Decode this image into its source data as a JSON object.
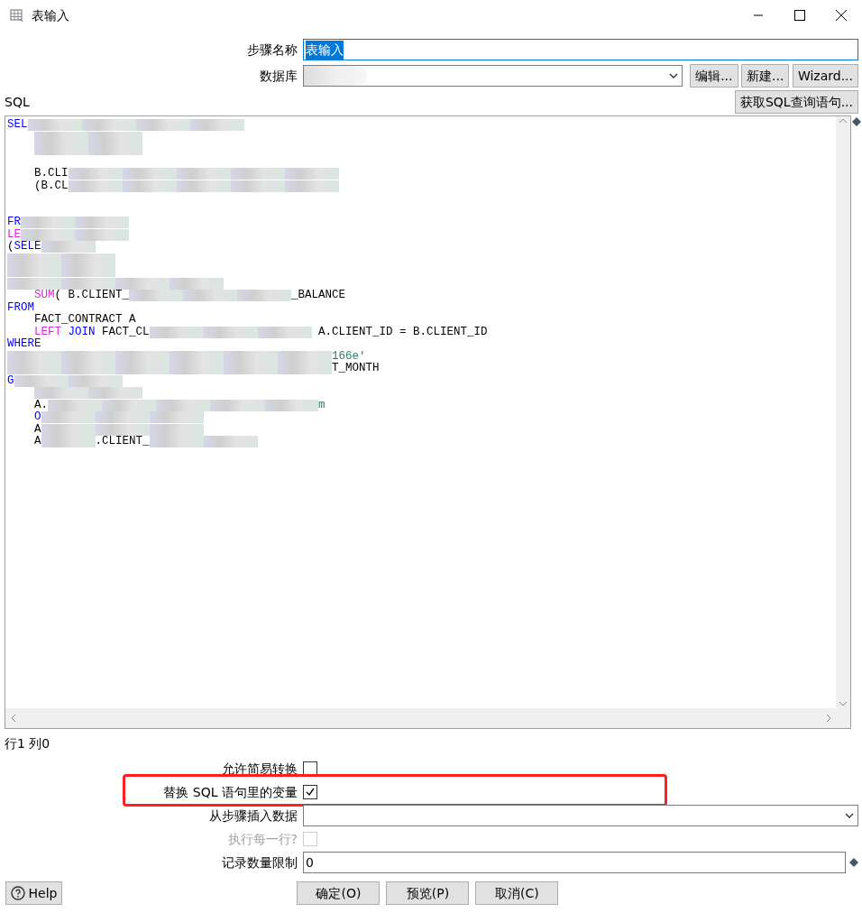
{
  "window": {
    "title": "表输入"
  },
  "step_name": {
    "label": "步骤名称",
    "value": "表输入"
  },
  "database": {
    "label": "数据库",
    "redacted": true,
    "buttons": [
      "编辑...",
      "新建...",
      "Wizard..."
    ]
  },
  "sql": {
    "label": "SQL",
    "fetch_button": "获取SQL查询语句...",
    "lines": [
      {
        "kind": "flush",
        "tokens": [
          {
            "kind": "keyword",
            "text": "SEL"
          },
          {
            "kind": "redacted"
          },
          {
            "kind": "redacted"
          },
          {
            "kind": "redacted"
          },
          {
            "kind": "redacted"
          }
        ]
      },
      {
        "kind": "indented",
        "tokens": [
          {
            "kind": "redacted"
          },
          {
            "kind": "redacted"
          }
        ]
      },
      {
        "kind": "indented",
        "tokens": [
          {
            "kind": "redacted"
          },
          {
            "kind": "redacted"
          }
        ]
      },
      {
        "kind": "blank"
      },
      {
        "kind": "indented",
        "tokens": [
          {
            "kind": "plain",
            "text": "B.CLI"
          },
          {
            "kind": "redacted"
          },
          {
            "kind": "redacted"
          },
          {
            "kind": "redacted"
          },
          {
            "kind": "redacted"
          },
          {
            "kind": "redacted"
          }
        ]
      },
      {
        "kind": "indented",
        "tokens": [
          {
            "kind": "plain",
            "text": "(B.CL"
          },
          {
            "kind": "redacted"
          },
          {
            "kind": "redacted"
          },
          {
            "kind": "redacted"
          },
          {
            "kind": "redacted"
          },
          {
            "kind": "redacted"
          }
        ]
      },
      {
        "kind": "blank"
      },
      {
        "kind": "blank"
      },
      {
        "kind": "flush",
        "tokens": [
          {
            "kind": "keyword",
            "text": "FR"
          },
          {
            "kind": "redacted"
          },
          {
            "kind": "redacted"
          }
        ]
      },
      {
        "kind": "flush",
        "tokens": [
          {
            "kind": "function",
            "text": "LE"
          },
          {
            "kind": "redacted"
          },
          {
            "kind": "redacted"
          }
        ]
      },
      {
        "kind": "flush",
        "tokens": [
          {
            "kind": "plain",
            "text": "("
          },
          {
            "kind": "keyword",
            "text": "SELE"
          },
          {
            "kind": "redacted"
          }
        ]
      },
      {
        "kind": "flush",
        "tokens": [
          {
            "kind": "redacted"
          },
          {
            "kind": "redacted"
          }
        ]
      },
      {
        "kind": "flush",
        "tokens": [
          {
            "kind": "redacted"
          },
          {
            "kind": "redacted"
          }
        ]
      },
      {
        "kind": "flush",
        "tokens": [
          {
            "kind": "redacted"
          },
          {
            "kind": "redacted"
          },
          {
            "kind": "redacted"
          },
          {
            "kind": "redacted"
          }
        ]
      },
      {
        "kind": "indented",
        "tokens": [
          {
            "kind": "function",
            "text": "SUM"
          },
          {
            "kind": "plain",
            "text": "( B.CLIENT_"
          },
          {
            "kind": "redacted"
          },
          {
            "kind": "redacted"
          },
          {
            "kind": "redacted"
          },
          {
            "kind": "plain",
            "text": "_BALANCE"
          }
        ]
      },
      {
        "kind": "flush",
        "tokens": [
          {
            "kind": "keyword",
            "text": "FROM"
          }
        ]
      },
      {
        "kind": "indented",
        "tokens": [
          {
            "kind": "plain",
            "text": "FACT_CONTRACT A"
          }
        ]
      },
      {
        "kind": "indented",
        "tokens": [
          {
            "kind": "function",
            "text": "LEFT"
          },
          {
            "kind": "keyword",
            "text": " JOIN"
          },
          {
            "kind": "plain",
            "text": " FACT_CL"
          },
          {
            "kind": "redacted"
          },
          {
            "kind": "redacted"
          },
          {
            "kind": "redacted"
          },
          {
            "kind": "plain",
            "text": " A.CLIENT_ID = B.CLIENT_ID"
          }
        ]
      },
      {
        "kind": "flush",
        "tokens": [
          {
            "kind": "keyword",
            "text": "WHERE"
          }
        ]
      },
      {
        "kind": "flush",
        "tokens": [
          {
            "kind": "redacted"
          },
          {
            "kind": "redacted"
          },
          {
            "kind": "redacted"
          },
          {
            "kind": "redacted"
          },
          {
            "kind": "redacted"
          },
          {
            "kind": "redacted"
          },
          {
            "kind": "string",
            "text": "166e'"
          }
        ]
      },
      {
        "kind": "flush",
        "tokens": [
          {
            "kind": "redacted"
          },
          {
            "kind": "redacted"
          },
          {
            "kind": "redacted"
          },
          {
            "kind": "redacted"
          },
          {
            "kind": "redacted"
          },
          {
            "kind": "redacted"
          },
          {
            "kind": "plain",
            "text": "T_MONTH"
          }
        ]
      },
      {
        "kind": "flush",
        "tokens": [
          {
            "kind": "keyword",
            "text": "G"
          },
          {
            "kind": "redacted"
          },
          {
            "kind": "redacted"
          }
        ]
      },
      {
        "kind": "indented",
        "tokens": [
          {
            "kind": "redacted"
          },
          {
            "kind": "redacted"
          }
        ]
      },
      {
        "kind": "indented",
        "tokens": [
          {
            "kind": "plain",
            "text": "A."
          },
          {
            "kind": "redacted"
          },
          {
            "kind": "redacted"
          },
          {
            "kind": "redacted"
          },
          {
            "kind": "redacted"
          },
          {
            "kind": "redacted"
          },
          {
            "kind": "string",
            "text": "m"
          }
        ]
      },
      {
        "kind": "indented",
        "tokens": [
          {
            "kind": "keyword",
            "text": "O"
          },
          {
            "kind": "redacted"
          },
          {
            "kind": "redacted"
          },
          {
            "kind": "redacted"
          }
        ]
      },
      {
        "kind": "indented",
        "tokens": [
          {
            "kind": "plain",
            "text": "A"
          },
          {
            "kind": "redacted"
          },
          {
            "kind": "redacted"
          },
          {
            "kind": "redacted"
          }
        ]
      },
      {
        "kind": "indented",
        "tokens": [
          {
            "kind": "plain",
            "text": "A"
          },
          {
            "kind": "redacted"
          },
          {
            "kind": "plain",
            "text": ".CLIENT_"
          },
          {
            "kind": "redacted"
          },
          {
            "kind": "redacted"
          }
        ]
      }
    ]
  },
  "cursor_position": "行1 列0",
  "options": [
    {
      "kind": "checkbox",
      "label": "允许简易转换",
      "checked": false,
      "disabled": false,
      "highlighted": false
    },
    {
      "kind": "checkbox",
      "label": "替换 SQL 语句里的变量",
      "checked": true,
      "disabled": false,
      "highlighted": true
    },
    {
      "kind": "dropdown",
      "label": "从步骤插入数据",
      "disabled": false,
      "highlighted": false
    },
    {
      "kind": "checkbox",
      "label": "执行每一行?",
      "checked": false,
      "disabled": true,
      "highlighted": false
    },
    {
      "kind": "text",
      "label": "记录数量限制",
      "value": "0",
      "disabled": false,
      "highlighted": false
    }
  ],
  "help_button": "Help",
  "buttons": [
    "确定(O)",
    "预览(P)",
    "取消(C)"
  ]
}
